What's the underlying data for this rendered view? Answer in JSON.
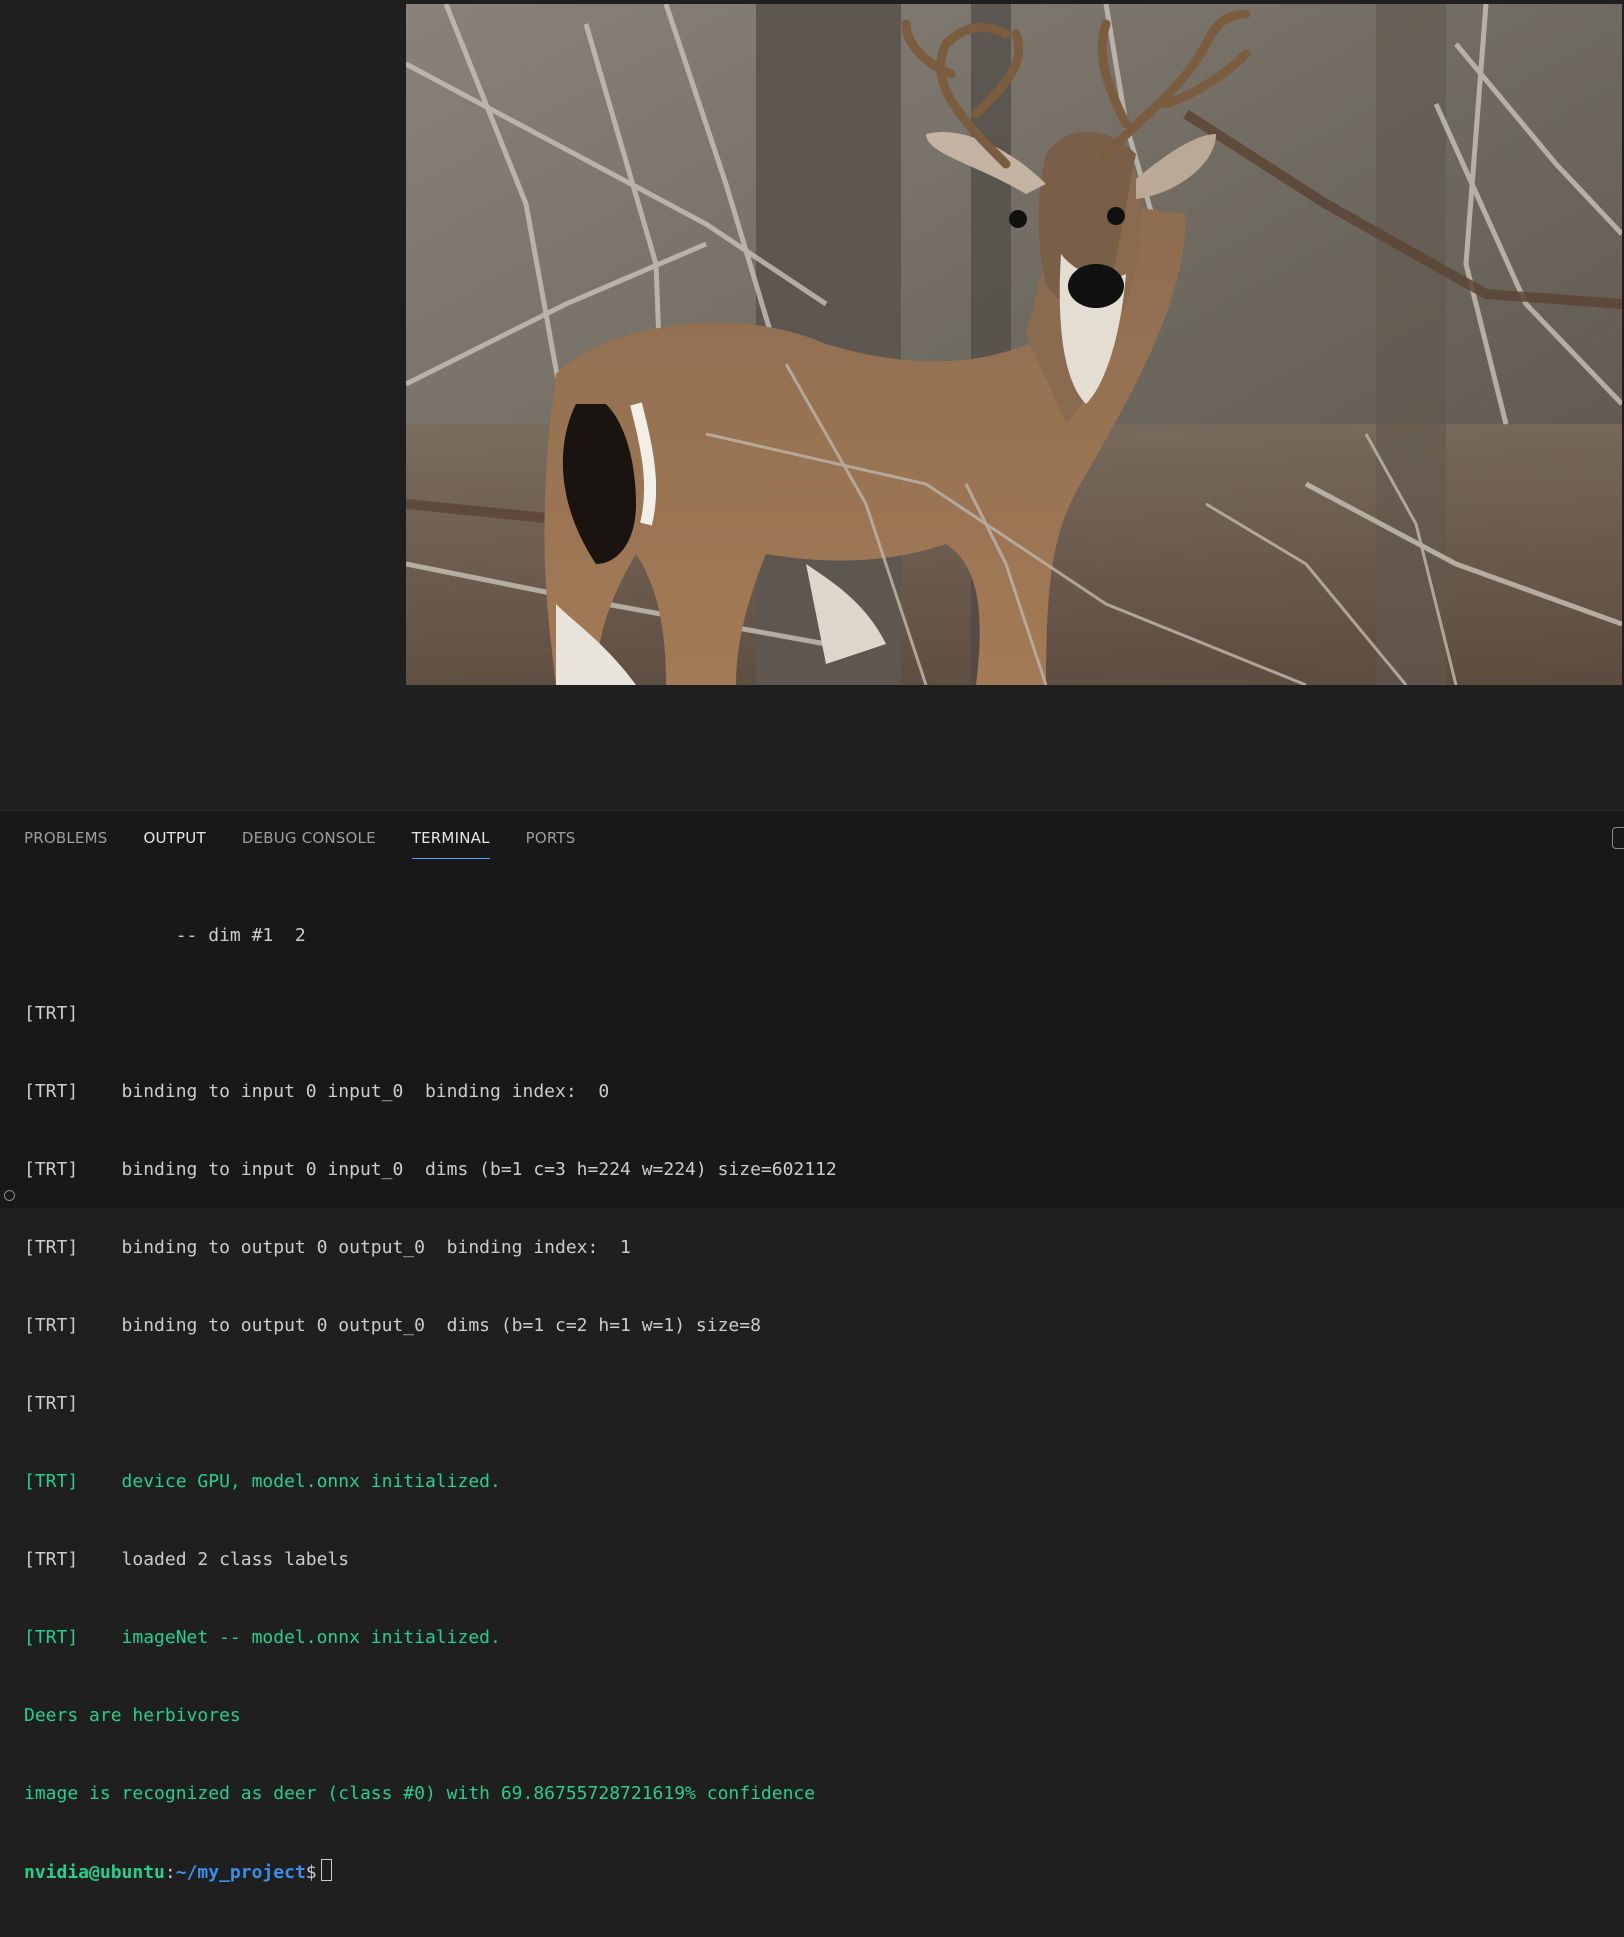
{
  "panel": {
    "tabs": [
      {
        "label": "PROBLEMS",
        "active": false
      },
      {
        "label": "OUTPUT",
        "active": false
      },
      {
        "label": "DEBUG CONSOLE",
        "active": false
      },
      {
        "label": "TERMINAL",
        "active": true
      },
      {
        "label": "PORTS",
        "active": false
      }
    ]
  },
  "terminal": {
    "lines": [
      {
        "tag": "",
        "text": "              -- dim #1  2",
        "style": "normal"
      },
      {
        "tag": "[TRT]",
        "text": "",
        "style": "normal"
      },
      {
        "tag": "[TRT]",
        "text": "    binding to input 0 input_0  binding index:  0",
        "style": "normal"
      },
      {
        "tag": "[TRT]",
        "text": "    binding to input 0 input_0  dims (b=1 c=3 h=224 w=224) size=602112",
        "style": "normal"
      },
      {
        "tag": "[TRT]",
        "text": "    binding to output 0 output_0  binding index:  1",
        "style": "normal"
      },
      {
        "tag": "[TRT]",
        "text": "    binding to output 0 output_0  dims (b=1 c=2 h=1 w=1) size=8",
        "style": "normal"
      },
      {
        "tag": "[TRT]",
        "text": "",
        "style": "normal"
      },
      {
        "tag": "[TRT]",
        "text": "    device GPU, model.onnx initialized.",
        "style": "green"
      },
      {
        "tag": "[TRT]",
        "text": "    loaded 2 class labels",
        "style": "normal"
      },
      {
        "tag": "[TRT]",
        "text": "    imageNet -- model.onnx initialized.",
        "style": "green"
      },
      {
        "tag": "",
        "text": "Deers are herbivores",
        "style": "green"
      },
      {
        "tag": "",
        "text": "image is recognized as deer (class #0) with 69.86755728721619% confidence",
        "style": "green"
      }
    ],
    "prompt": {
      "user_host": "nvidia@ubuntu",
      "separator": ":",
      "path": "~/my_project",
      "dollar": "$"
    }
  },
  "colors": {
    "background": "#1f1f1f",
    "panel_background": "#181818",
    "terminal_text": "#cccccc",
    "terminal_green": "#23d18b",
    "terminal_blue": "#3b8eea",
    "active_tab_underline": "#4da3ff"
  }
}
